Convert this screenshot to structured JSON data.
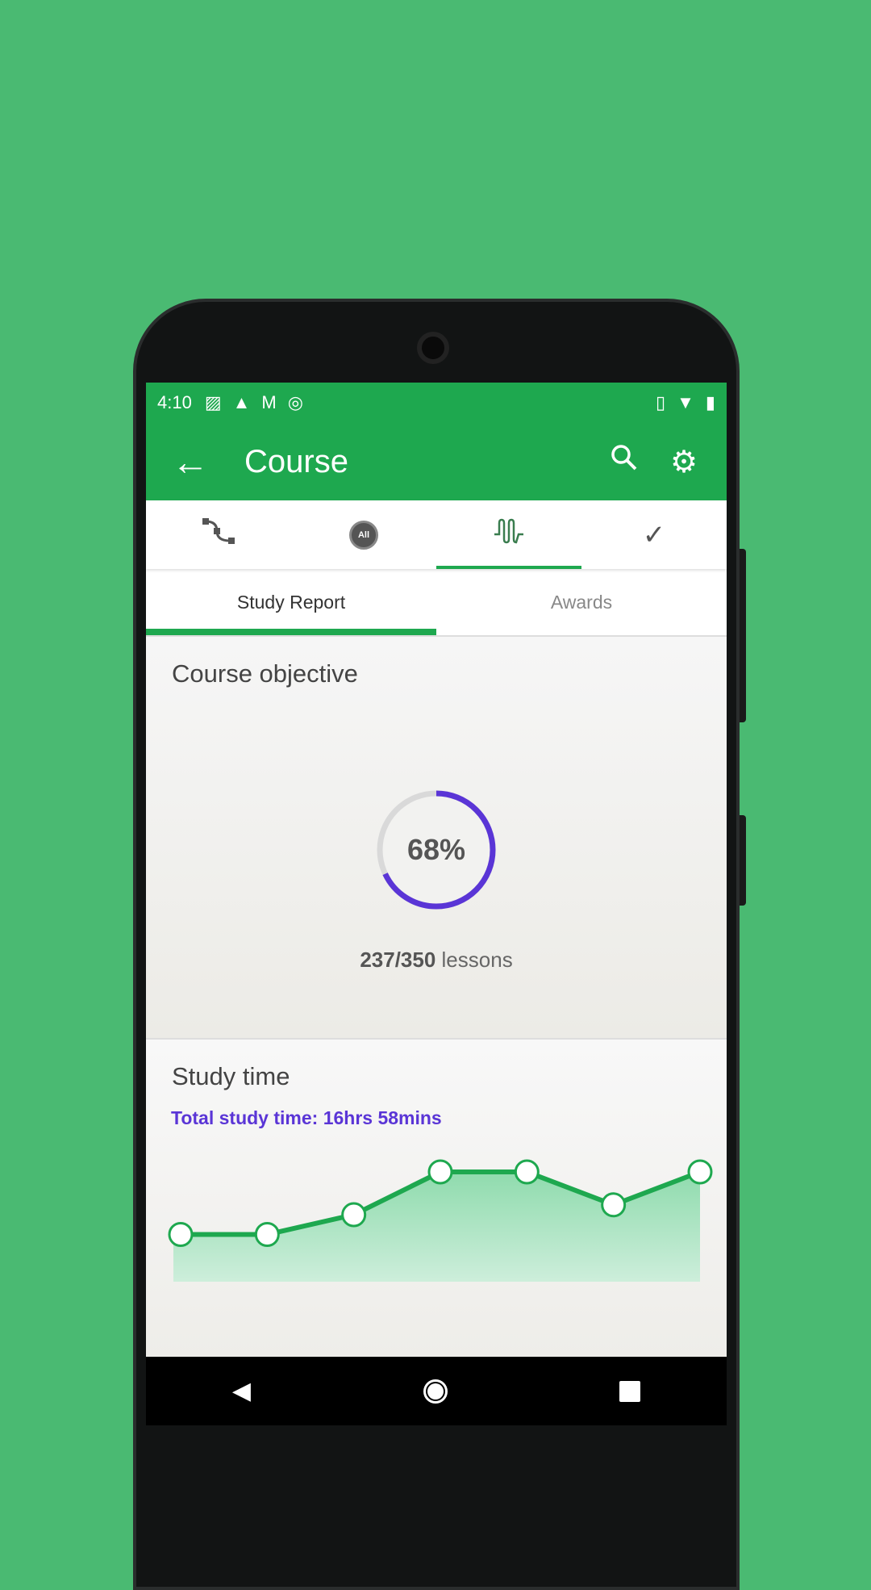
{
  "status_bar": {
    "time": "4:10",
    "left_icons": [
      "image-icon",
      "warning-icon",
      "gmail-icon",
      "sync-icon"
    ],
    "right_icons": [
      "vibrate-icon",
      "wifi-icon",
      "battery-icon"
    ]
  },
  "app_bar": {
    "title": "Course",
    "back_icon": "arrow-left-icon",
    "actions": [
      "search-icon",
      "settings-gear-icon"
    ]
  },
  "icon_tabs": [
    {
      "icon": "path-icon"
    },
    {
      "icon": "all-badge-icon",
      "label": "All"
    },
    {
      "icon": "wave-chart-icon",
      "active": true
    },
    {
      "icon": "checkmark-icon"
    }
  ],
  "sub_tabs": [
    {
      "label": "Study Report",
      "active": true
    },
    {
      "label": "Awards"
    }
  ],
  "course_objective": {
    "title": "Course objective",
    "percent_label": "68%",
    "percent": 68,
    "completed": "237/350",
    "unit": "lessons",
    "ring_color": "#5a35d6"
  },
  "study_time": {
    "title": "Study time",
    "total": "Total study time: 16hrs 58mins"
  },
  "chart_data": {
    "type": "area",
    "values": [
      4.3,
      4.3,
      6.1,
      10,
      10,
      7,
      10
    ],
    "ylim": [
      0,
      10
    ],
    "grid": false,
    "line_color": "#1ea84f",
    "fill_color": "#a3e2bb"
  },
  "colors": {
    "brand": "#1ea84f",
    "accent": "#5a35d6",
    "background": "#4aba72"
  },
  "nav_bar": {
    "icons": [
      "back-triangle-icon",
      "home-circle-icon",
      "recents-square-icon"
    ]
  }
}
